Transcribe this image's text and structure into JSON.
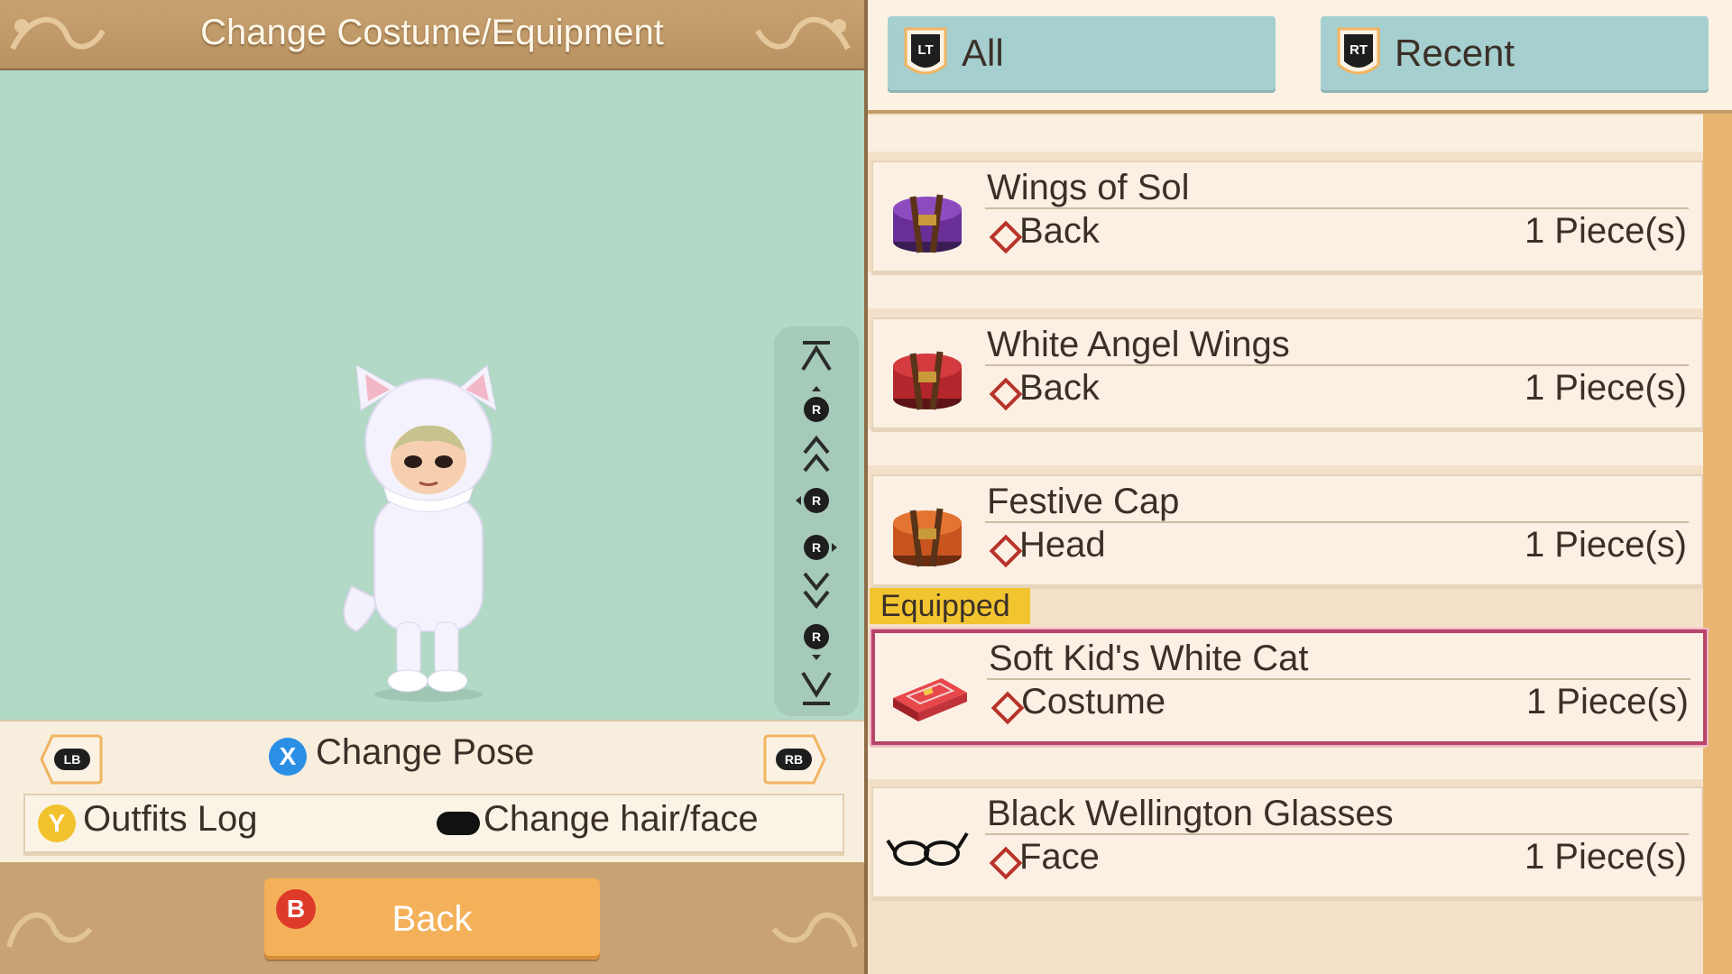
{
  "title": "Change Costume/Equipment",
  "controls": {
    "lb": "LB",
    "rb": "RB",
    "x_button": "X",
    "change_pose": "Change Pose",
    "y_button": "Y",
    "outfits_log": "Outfits Log",
    "change_hair_face": "Change hair/face",
    "b_button": "B",
    "back": "Back",
    "camera_button": "R"
  },
  "tabs": [
    {
      "trigger": "LT",
      "label": "All"
    },
    {
      "trigger": "RT",
      "label": "Recent"
    }
  ],
  "equipped_label": "Equipped",
  "items": [
    {
      "name": "Wings of Sol",
      "category": "Back",
      "quantity": "1 Piece(s)",
      "icon": "purple-box-icon",
      "color": "#6a2f96"
    },
    {
      "name": "White Angel Wings",
      "category": "Back",
      "quantity": "1 Piece(s)",
      "icon": "red-box-icon",
      "color": "#b3262b"
    },
    {
      "name": "Festive Cap",
      "category": "Head",
      "quantity": "1 Piece(s)",
      "icon": "orange-box-icon",
      "color": "#c8541e"
    },
    {
      "name": "Soft Kid's White Cat",
      "category": "Costume",
      "quantity": "1 Piece(s)",
      "icon": "costume-case-icon",
      "color": "#d8343b",
      "equipped": true
    },
    {
      "name": "Black Wellington Glasses",
      "category": "Face",
      "quantity": "1 Piece(s)",
      "icon": "glasses-icon",
      "color": "#111111"
    }
  ],
  "colors": {
    "accent_tab": "#a6cfcf",
    "selected_border": "#b8456a",
    "equipped_tag": "#f2c530",
    "back_button": "#f4b15a"
  }
}
